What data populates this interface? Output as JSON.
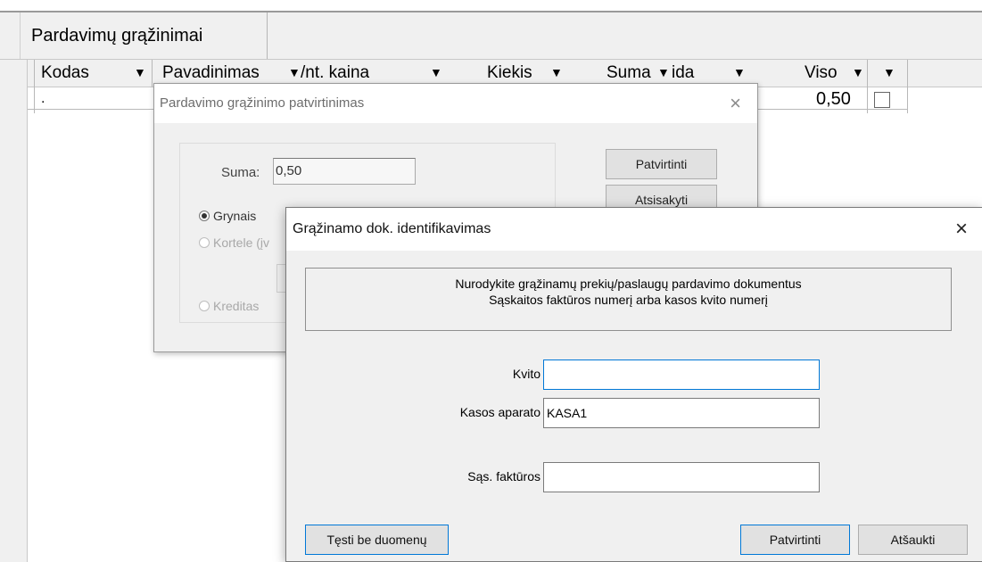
{
  "tab": {
    "label": "Pardavimų grąžinimai"
  },
  "grid": {
    "columns": [
      "Kodas",
      "Pavadinimas",
      "/nt. kaina",
      "Kiekis",
      "Suma",
      "ida",
      "Viso",
      ""
    ],
    "filter_arrow": "▼",
    "row": {
      "code": ".",
      "total": "0,50",
      "checked": false
    }
  },
  "confirm_dialog": {
    "title": "Pardavimo grąžinimo patvirtinimas",
    "close": "×",
    "suma_label": "Suma:",
    "suma_value": "0,50",
    "payment_options": [
      {
        "label": "Grynais",
        "selected": true,
        "enabled": true
      },
      {
        "label": "Kortele (įv",
        "selected": false,
        "enabled": false
      },
      {
        "label": "Kreditas",
        "selected": false,
        "enabled": false
      }
    ],
    "confirm_button": "Patvirtinti",
    "cancel_button": "Atsisakyti"
  },
  "identify_dialog": {
    "title": "Grąžinamo dok. identifikavimas",
    "close": "×",
    "instruction_line1": "Nurodykite grąžinamų prekių/paslaugų pardavimo dokumentus",
    "instruction_line2": "Sąskaitos faktūros numerį arba kasos kvito numerį",
    "fields": {
      "receipt_label": "Kvito",
      "receipt_value": "",
      "register_label": "Kasos aparato",
      "register_value": "KASA1",
      "invoice_label": "Sąs. faktūros",
      "invoice_value": ""
    },
    "continue_button": "Tęsti be duomenų",
    "confirm_button": "Patvirtinti",
    "cancel_button": "Atšaukti"
  },
  "colors": {
    "focus_border": "#0078d7",
    "dialog_bg": "#f0f0f0"
  }
}
